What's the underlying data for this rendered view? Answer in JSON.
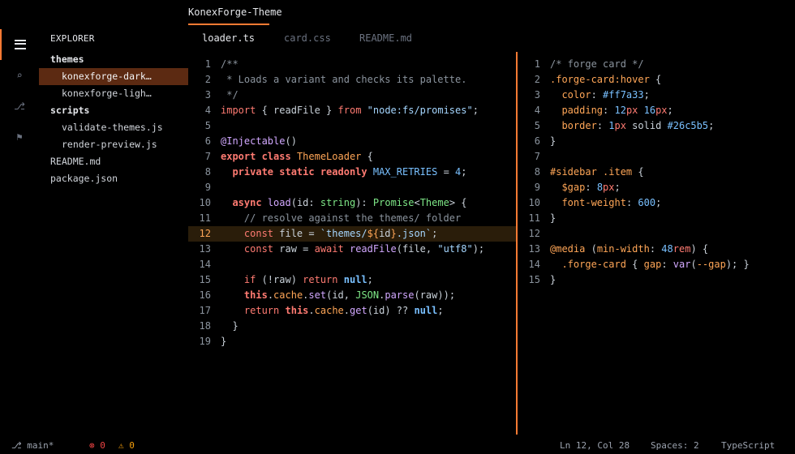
{
  "window": {
    "title": "KonexForge-Theme"
  },
  "activity_bar": {
    "items": [
      {
        "name": "explorer-icon",
        "glyph": ""
      },
      {
        "name": "search-icon",
        "glyph": "⌕"
      },
      {
        "name": "source-control-icon",
        "glyph": "⎇"
      },
      {
        "name": "flag-icon",
        "glyph": "⚑"
      }
    ]
  },
  "explorer": {
    "title": "EXPLORER",
    "items": [
      {
        "label": "themes",
        "type": "folder"
      },
      {
        "label": "konexforge-dark.json",
        "type": "file",
        "selected": true
      },
      {
        "label": "konexforge-light.json",
        "type": "file"
      },
      {
        "label": "scripts",
        "type": "folder"
      },
      {
        "label": "validate-themes.js",
        "type": "file"
      },
      {
        "label": "render-preview.js",
        "type": "file"
      },
      {
        "label": "README.md",
        "type": "root-file"
      },
      {
        "label": "package.json",
        "type": "root-file"
      }
    ]
  },
  "tabs": [
    {
      "label": "loader.ts",
      "active": true
    },
    {
      "label": "card.css",
      "active": false
    },
    {
      "label": "README.md",
      "active": false
    }
  ],
  "left_pane": {
    "lines": [
      {
        "n": "1",
        "text": "/**"
      },
      {
        "n": "2",
        "text": " * Loads a variant and checks its palette."
      },
      {
        "n": "3",
        "text": " */"
      },
      {
        "n": "4",
        "text": "import { readFile } from \"node:fs/promises\";"
      },
      {
        "n": "5",
        "text": ""
      },
      {
        "n": "6",
        "text": "@Injectable()"
      },
      {
        "n": "7",
        "text": "export class ThemeLoader {"
      },
      {
        "n": "8",
        "text": "  private static readonly MAX_RETRIES = 4;"
      },
      {
        "n": "9",
        "text": ""
      },
      {
        "n": "10",
        "text": "  async load(id: string): Promise<Theme> {"
      },
      {
        "n": "11",
        "text": "    // resolve against the themes/ folder"
      },
      {
        "n": "12",
        "text": "    const file = `themes/${id}.json`;"
      },
      {
        "n": "13",
        "text": "    const raw = await readFile(file, \"utf8\");"
      },
      {
        "n": "14",
        "text": ""
      },
      {
        "n": "15",
        "text": "    if (!raw) return null;"
      },
      {
        "n": "16",
        "text": "    this.cache.set(id, JSON.parse(raw));"
      },
      {
        "n": "17",
        "text": "    return this.cache.get(id) ?? null;"
      },
      {
        "n": "18",
        "text": "  }"
      },
      {
        "n": "19",
        "text": "}"
      }
    ]
  },
  "right_pane": {
    "lines": [
      {
        "n": "1",
        "text": "/* forge card */"
      },
      {
        "n": "2",
        "text": ".forge-card:hover {"
      },
      {
        "n": "3",
        "text": "  color: #ff7a33;"
      },
      {
        "n": "4",
        "text": "  padding: 12px 16px;"
      },
      {
        "n": "5",
        "text": "  border: 1px solid #26c5b5;"
      },
      {
        "n": "6",
        "text": "}"
      },
      {
        "n": "7",
        "text": ""
      },
      {
        "n": "8",
        "text": "#sidebar .item {"
      },
      {
        "n": "9",
        "text": "  $gap: 8px;"
      },
      {
        "n": "10",
        "text": "  font-weight: 600;"
      },
      {
        "n": "11",
        "text": "}"
      },
      {
        "n": "12",
        "text": ""
      },
      {
        "n": "13",
        "text": "@media (min-width: 48rem) {"
      },
      {
        "n": "14",
        "text": "  .forge-card { gap: var(--gap); }"
      },
      {
        "n": "15",
        "text": "}"
      }
    ]
  },
  "status_bar": {
    "branch": "⎇ main*",
    "errors": "⊗ 0",
    "warnings": "⚠ 0",
    "cursor": "Ln 12, Col 28",
    "indent": "Spaces: 2",
    "language": "TypeScript"
  },
  "colors": {
    "accent": "#ff7a33",
    "background": "#000000",
    "selection": "#5c2a12",
    "current_line": "#2a1d0a"
  }
}
